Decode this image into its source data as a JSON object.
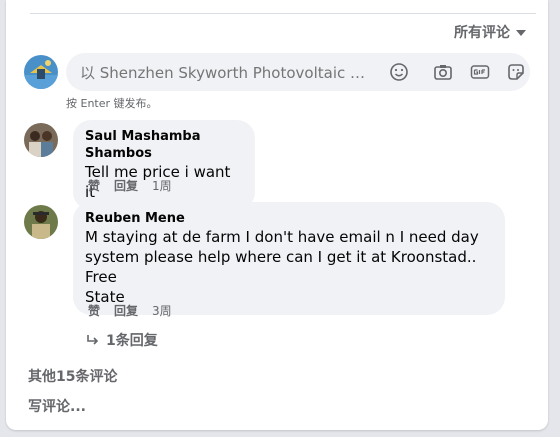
{
  "sort": {
    "label": "所有评论"
  },
  "composer": {
    "placeholder": "以 Shenzhen Skyworth Photovoltaic Technology Co., Ltd 的身份评论",
    "hint": "按 Enter 键发布。",
    "icons": [
      "emoji-icon",
      "camera-icon",
      "gif-icon",
      "sticker-icon"
    ]
  },
  "comments": [
    {
      "author": "Saul Mashamba Shambos",
      "text": "Tell me price i want it",
      "like": "赞",
      "reply": "回复",
      "time": "1周"
    },
    {
      "author": "Reuben Mene",
      "text_lines": [
        "M staying at de farm I don't have email n I need day",
        "system please help where can I get it at Kroonstad.. Free",
        "State"
      ],
      "like": "赞",
      "reply": "回复",
      "time": "3周",
      "replies_label": "1条回复"
    }
  ],
  "footer": {
    "more_comments": "其他15条评论",
    "write_comment": "写评论..."
  },
  "colors": {
    "secondary_text": "#65676b",
    "bubble": "#f0f2f5",
    "background": "#e4e6eb"
  }
}
